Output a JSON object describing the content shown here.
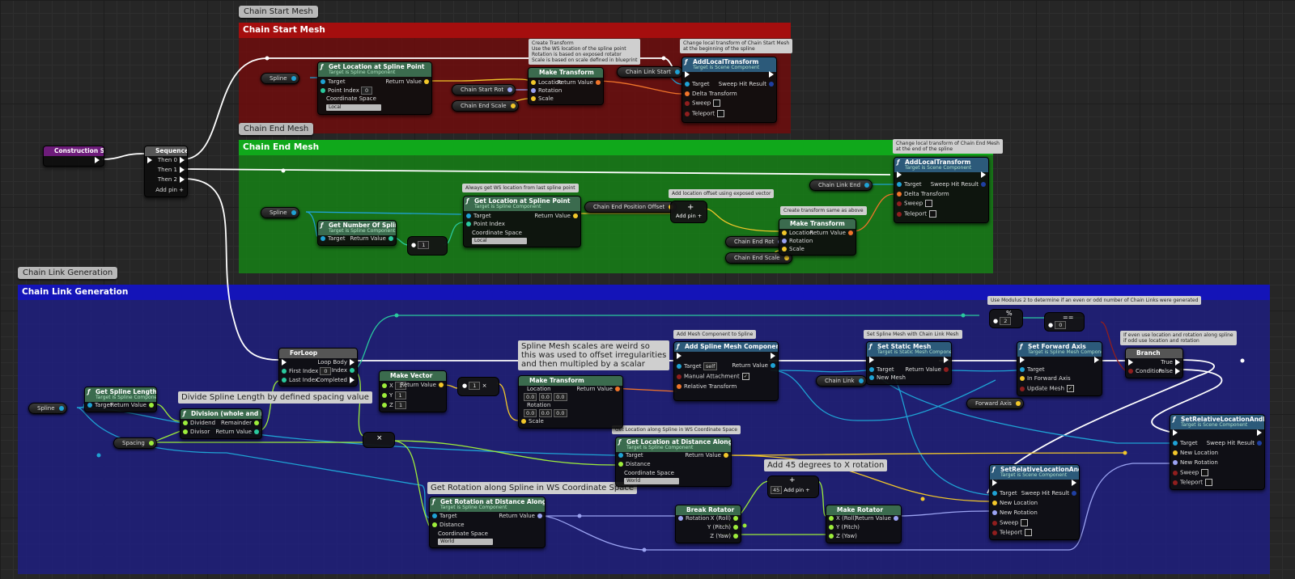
{
  "colors": {
    "exec": "#ffffff",
    "object": "#1fa2d4",
    "float": "#9ded3b",
    "int": "#2ac99e",
    "vector": "#f2c72a",
    "rotator": "#9ba3f2",
    "transform": "#f0742a",
    "bool": "#8f1e1e"
  },
  "comments": {
    "start": {
      "tab": "Chain Start Mesh",
      "title": "Chain Start Mesh"
    },
    "end": {
      "tab": "Chain End Mesh",
      "title": "Chain End Mesh"
    },
    "link": {
      "tab": "Chain Link Generation",
      "title": "Chain Link Generation"
    }
  },
  "notes": {
    "create_transform": "Create Transform\nUse the WS location of the spline point\nRotation is based on exposed rotator\nScale is based on scale defined in blueprint",
    "local_start": "Change local transform of Chain Start Mesh\nat the beginning of the spline",
    "local_end": "Change local transform of Chain End Mesh\nat the end of the spline",
    "ws_last": "Always get WS location from last spline point",
    "offset": "Add location offset using exposed vector",
    "same": "Create transform same as above",
    "divide": "Divide Spline Length by defined spacing value",
    "weird": "Spline Mesh scales are weird so\nthis was used to offset irregularities\nand then multipled by a scalar",
    "add_mesh": "Add Mesh Component to Spline",
    "set_static": "Set Spline Mesh with Chain Link Mesh",
    "modulus": "Use Modulus 2 to determine if an even or odd number of Chain Links were generated",
    "branch": "If even use location and rotation along spline\nif odd use location and rotation",
    "get_loc_ws": "Get Location along Spline in WS Coordinate Space",
    "get_rot_ws": "Get Rotation along Spline in WS Coordinate Space",
    "add45": "Add 45 degrees to X rotation"
  },
  "nodes": {
    "construction": {
      "title": "Construction Script"
    },
    "sequence": {
      "title": "Sequence",
      "then0": "Then 0",
      "then1": "Then 1",
      "then2": "Then 2",
      "addpin": "Add pin +"
    },
    "gl1": {
      "title": "Get Location at Spline Point",
      "sub": "Target is Spline Component",
      "target": "Target",
      "point_index": "Point Index",
      "point_val": "0",
      "cs": "Coordinate Space",
      "cs_val": "Local",
      "ret": "Return Value"
    },
    "mt1": {
      "title": "Make Transform",
      "loc": "Location",
      "rot": "Rotation",
      "scale": "Scale",
      "ret": "Return Value"
    },
    "alt1": {
      "title": "AddLocalTransform",
      "sub": "Target is Scene Component",
      "target": "Target",
      "delta": "Delta Transform",
      "sweep": "Sweep",
      "teleport": "Teleport",
      "hit": "Sweep Hit Result"
    },
    "gnsp": {
      "title": "Get Number Of Spline Points",
      "sub": "Target is Spline Component",
      "target": "Target",
      "ret": "Return Value"
    },
    "gl2": {
      "title": "Get Location at Spline Point",
      "sub": "Target is Spline Component",
      "target": "Target",
      "point_index": "Point Index",
      "cs": "Coordinate Space",
      "cs_val": "Local",
      "ret": "Return Value"
    },
    "addv": {
      "addpin": "Add pin +"
    },
    "mt2": {
      "title": "Make Transform",
      "loc": "Location",
      "rot": "Rotation",
      "scale": "Scale",
      "ret": "Return Value"
    },
    "alt2": {
      "title": "AddLocalTransform",
      "sub": "Target is Scene Component",
      "target": "Target",
      "delta": "Delta Transform",
      "sweep": "Sweep",
      "teleport": "Teleport",
      "hit": "Sweep Hit Result"
    },
    "gsl": {
      "title": "Get Spline Length",
      "sub": "Target is Spline Component",
      "target": "Target",
      "ret": "Return Value"
    },
    "div": {
      "title": "Division (whole and remainder)",
      "dividend": "Dividend",
      "divisor": "Divisor",
      "rem": "Remainder",
      "ret": "Return Value"
    },
    "forloop": {
      "title": "ForLoop",
      "first": "First Index",
      "first_val": "0",
      "last": "Last Index",
      "body": "Loop Body",
      "index": "Index",
      "completed": "Completed"
    },
    "mv": {
      "title": "Make Vector",
      "x": "X",
      "y": "Y",
      "z": "Z",
      "xv": "1",
      "yv": "1",
      "zv": "1",
      "ret": "Return Value"
    },
    "mt3": {
      "title": "Make Transform",
      "loc": "Location",
      "rot": "Rotation",
      "scale": "Scale",
      "ret": "Return Value",
      "zero": "0.0"
    },
    "asmc": {
      "title": "Add Spline Mesh Component",
      "sub": "Target is Actor",
      "target": "Target",
      "self": "self",
      "manual": "Manual Attachment",
      "rel": "Relative Transform",
      "ret": "Return Value"
    },
    "ssm": {
      "title": "Set Static Mesh",
      "sub": "Target is Static Mesh Component",
      "target": "Target",
      "new": "New Mesh",
      "ret": "Return Value"
    },
    "sfa": {
      "title": "Set Forward Axis",
      "sub": "Target is Spline Mesh Component",
      "target": "Target",
      "axis": "In Forward Axis",
      "update": "Update Mesh"
    },
    "branch": {
      "title": "Branch",
      "cond": "Condition",
      "t": "True",
      "f": "False"
    },
    "srlr1": {
      "title": "SetRelativeLocationAndRotation",
      "sub": "Target is Scene Component",
      "target": "Target",
      "loc": "New Location",
      "rot": "New Rotation",
      "sweep": "Sweep",
      "teleport": "Teleport",
      "hit": "Sweep Hit Result"
    },
    "srlr2": {
      "title": "SetRelativeLocationAndRotation",
      "sub": "Target is Scene Component",
      "target": "Target",
      "loc": "New Location",
      "rot": "New Rotation",
      "sweep": "Sweep",
      "teleport": "Teleport",
      "hit": "Sweep Hit Result"
    },
    "glad": {
      "title": "Get Location at Distance Along Spline",
      "sub": "Target is Spline Component",
      "target": "Target",
      "dist": "Distance",
      "cs": "Coordinate Space",
      "cs_val": "World",
      "ret": "Return Value"
    },
    "grad": {
      "title": "Get Rotation at Distance Along Spline",
      "sub": "Target is Spline Component",
      "target": "Target",
      "dist": "Distance",
      "cs": "Coordinate Space",
      "cs_val": "World",
      "ret": "Return Value"
    },
    "br": {
      "title": "Break Rotator",
      "rot": "Rotation",
      "x": "X (Roll)",
      "y": "Y (Pitch)",
      "z": "Z (Yaw)"
    },
    "mr": {
      "title": "Make Rotator",
      "x": "X (Roll)",
      "y": "Y (Pitch)",
      "z": "Z (Yaw)",
      "ret": "Return Value"
    },
    "add45": {
      "val": "45",
      "addpin": "Add pin +"
    }
  },
  "ops": {
    "minus1": "1",
    "mod2": "2",
    "eq0": "0",
    "mult": "×",
    "plus": "+",
    "eq": "==",
    "pct": "%"
  },
  "vars": {
    "spline1": "Spline",
    "spline2": "Spline",
    "spline3": "Spline",
    "start_rot": "Chain Start Rot",
    "end_scale1": "Chain End Scale",
    "link_start": "Chain Link Start",
    "link_end": "Chain Link End",
    "end_offset": "Chain End Position Offset",
    "end_rot": "Chain End Rot",
    "end_scale2": "Chain End Scale",
    "spacing": "Spacing",
    "chain_link": "Chain Link",
    "forward_axis": "Forward Axis"
  }
}
